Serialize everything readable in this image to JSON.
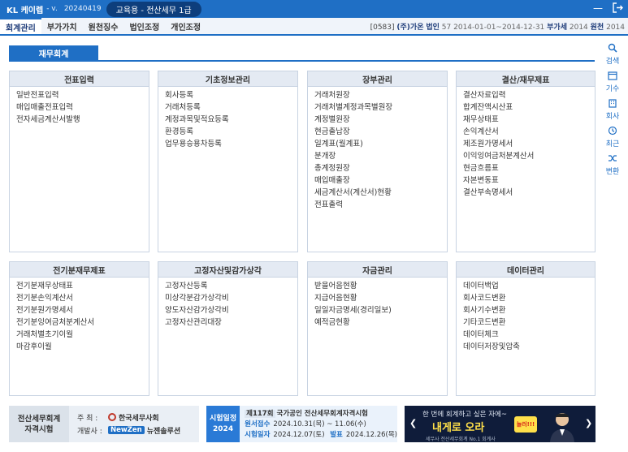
{
  "titlebar": {
    "brand": "KL 케이렙",
    "version": "- v.",
    "build": "20240419",
    "edition": "교육용 - 전산세무 1급"
  },
  "menubar": {
    "tabs": [
      "회계관리",
      "부가가치",
      "원천징수",
      "법인조정",
      "개인조정"
    ],
    "company": {
      "code": "[0583]",
      "name": "(주)가온",
      "type": "법인",
      "period_no": "57",
      "period": "2014-01-01~2014-12-31",
      "vat_label": "부가세",
      "vat_year": "2014",
      "withhold_label": "원천",
      "withhold_year": "2014"
    }
  },
  "section_tab": "재무회계",
  "side_tools": [
    {
      "label": "검색",
      "icon": "search-icon"
    },
    {
      "label": "기수",
      "icon": "calendar-icon"
    },
    {
      "label": "회사",
      "icon": "company-icon"
    },
    {
      "label": "최근",
      "icon": "recent-icon"
    },
    {
      "label": "변환",
      "icon": "shuffle-icon"
    }
  ],
  "panels": [
    {
      "title": "전표입력",
      "items": [
        "일반전표입력",
        "매입매출전표입력",
        "전자세금계산서발행"
      ]
    },
    {
      "title": "기초정보관리",
      "items": [
        "회사등록",
        "거래처등록",
        "계정과목및적요등록",
        "환경등록",
        "업무용승용차등록"
      ]
    },
    {
      "title": "장부관리",
      "items": [
        "거래처원장",
        "거래처별계정과목별원장",
        "계정별원장",
        "현금출납장",
        "일계표(월계표)",
        "분개장",
        "총계정원장",
        "매입매출장",
        "세금계산서(계산서)현황",
        "전표출력"
      ]
    },
    {
      "title": "결산/재무제표",
      "items": [
        "결산자료입력",
        "합계잔액시산표",
        "재무상태표",
        "손익계산서",
        "제조원가명세서",
        "이익잉여금처분계산서",
        "현금흐름표",
        "자본변동표",
        "결산부속명세서"
      ]
    },
    {
      "title": "전기분재무제표",
      "items": [
        "전기분재무상태표",
        "전기분손익계산서",
        "전기분원가명세서",
        "전기분잉여금처분계산서",
        "거래처별초기이월",
        "마감후이월"
      ]
    },
    {
      "title": "고정자산및감가상각",
      "items": [
        "고정자산등록",
        "미상각분감가상각비",
        "양도자산감가상각비",
        "고정자산관리대장"
      ]
    },
    {
      "title": "자금관리",
      "items": [
        "받을어음현황",
        "지급어음현황",
        "일일자금명세(경리일보)",
        "예적금현황"
      ]
    },
    {
      "title": "데이터관리",
      "items": [
        "데이터백업",
        "회사코드변환",
        "회사기수변환",
        "기타코드변환",
        "데이터체크",
        "데이터저장및압축"
      ]
    }
  ],
  "banner1": {
    "title_line1": "전산세무회계",
    "title_line2": "자격시험",
    "host_label": "주 최 :",
    "host": "한국세무사회",
    "dev_label": "개발사 :",
    "dev_logo": "NewZen",
    "dev_name": "뉴젠솔루션"
  },
  "banner2": {
    "label_line1": "시험일정",
    "label_line2": "2024",
    "round": "제117회",
    "title": "국가공인 전산세무회계자격시험",
    "apply_label": "원서접수",
    "apply_value": "2024.10.31(목) ~ 11.06(수)",
    "exam_label": "시험일자",
    "exam_value": "2024.12.07(토)",
    "result_label": "발표",
    "result_value": "2024.12.26(목)"
  },
  "banner3": {
    "sub": "한 번에 회계하고 싶은 자에~",
    "main": "내게로 오라",
    "badge": "놀러!!!",
    "foot": "세무사 전산세무회계 No.1 회계사"
  },
  "colors": {
    "primary": "#1f6fc5",
    "panel_header": "#e4eaf3",
    "banner_dark": "#0f1c3a",
    "accent_yellow": "#ffe04a"
  }
}
